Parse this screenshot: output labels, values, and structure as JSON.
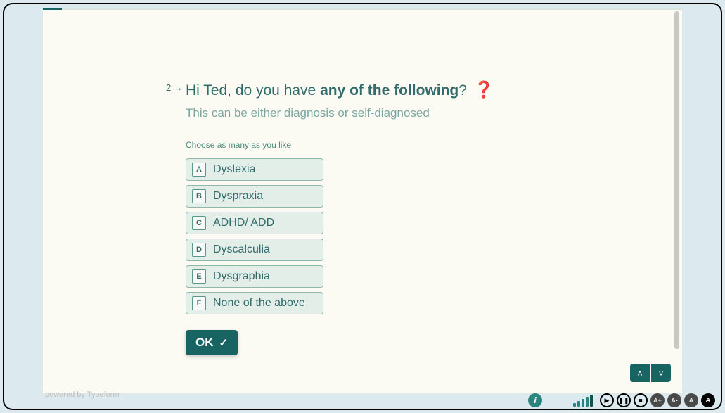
{
  "question": {
    "number": "2",
    "arrow": "→",
    "title_prefix": "Hi Ted, do you have ",
    "title_bold": "any of the following",
    "title_suffix": "?",
    "emoji": "❓",
    "subtitle": "This can be either diagnosis or self-diagnosed",
    "hint": "Choose as many as you like"
  },
  "options": [
    {
      "key": "A",
      "label": "Dyslexia"
    },
    {
      "key": "B",
      "label": "Dyspraxia"
    },
    {
      "key": "C",
      "label": "ADHD/ ADD"
    },
    {
      "key": "D",
      "label": "Dyscalculia"
    },
    {
      "key": "E",
      "label": "Dysgraphia"
    },
    {
      "key": "F",
      "label": "None of the above"
    }
  ],
  "ok_label": "OK",
  "powered_by": "powered by Typeform",
  "brand_letter": "i",
  "media": {
    "play": "▶",
    "pause": "❚❚",
    "stop": "■",
    "a": "A"
  }
}
